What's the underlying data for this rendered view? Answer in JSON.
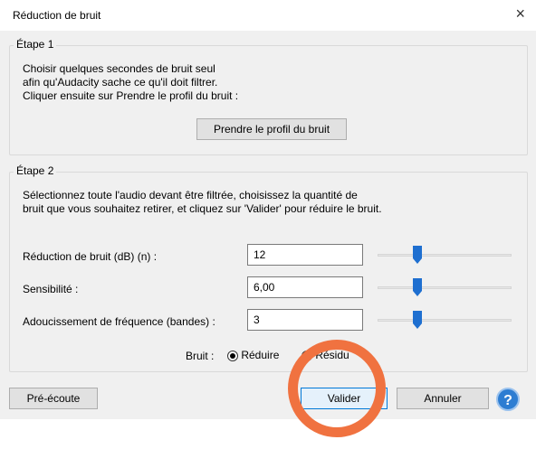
{
  "window": {
    "title": "Réduction de bruit",
    "close_glyph": "×"
  },
  "step1": {
    "legend": "Étape 1",
    "lines": [
      "Choisir quelques secondes de bruit seul",
      "afin qu'Audacity sache ce qu'il doit filtrer.",
      "Cliquer ensuite sur Prendre le profil du bruit :"
    ],
    "button_label": "Prendre le profil du bruit"
  },
  "step2": {
    "legend": "Étape 2",
    "lines": [
      "Sélectionnez toute l'audio devant être filtrée, choisissez la quantité de",
      "bruit que vous souhaitez retirer, et cliquez sur 'Valider' pour réduire le bruit."
    ],
    "rows": [
      {
        "label": "Réduction de bruit (dB) (n) :",
        "value": "12",
        "slider_level": 0.28
      },
      {
        "label": "Sensibilité :",
        "value": "6,00",
        "slider_level": 0.28
      },
      {
        "label": "Adoucissement de fréquence (bandes) :",
        "value": "3",
        "slider_level": 0.28
      }
    ],
    "noise_label": "Bruit :",
    "noise_options": [
      {
        "label": "Réduire",
        "selected": true
      },
      {
        "label": "Résidu",
        "selected": false
      }
    ]
  },
  "footer": {
    "preview_label": "Pré-écoute",
    "ok_label": "Valider",
    "cancel_label": "Annuler",
    "help_glyph": "?"
  },
  "colors": {
    "accent": "#0078d7",
    "slider_thumb": "#1e6fd0",
    "annotation": "#f07240",
    "dialog_bg": "#f0f0f0"
  }
}
